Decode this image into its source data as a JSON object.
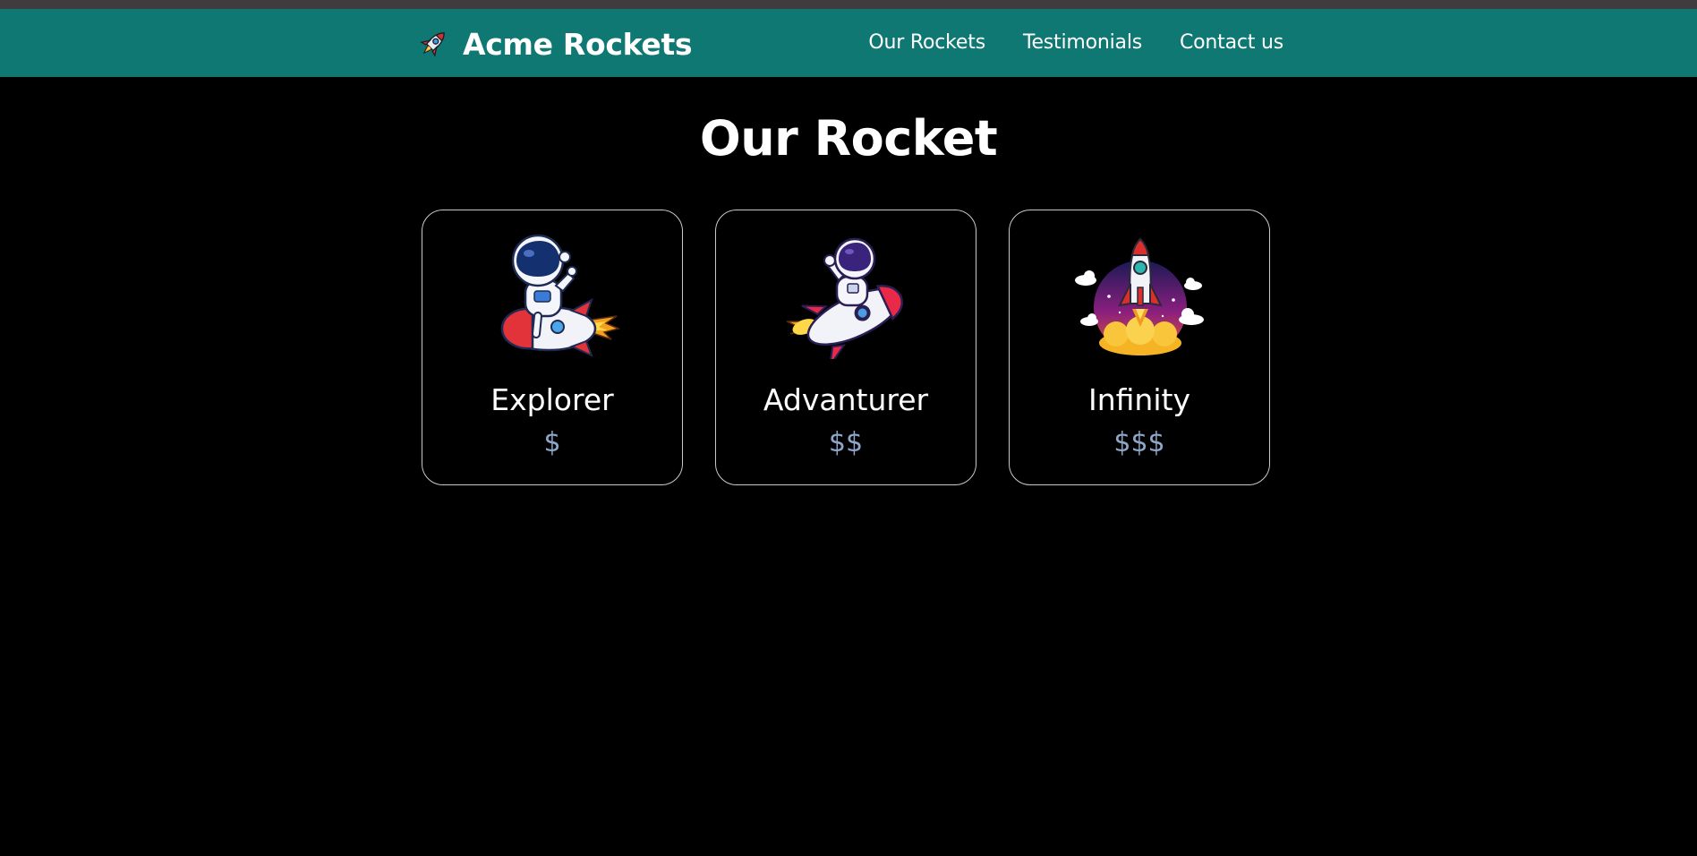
{
  "brand": {
    "name": "Acme Rockets",
    "icon": "rocket-icon"
  },
  "nav": {
    "items": [
      {
        "label": "Our Rockets"
      },
      {
        "label": "Testimonials"
      },
      {
        "label": "Contact us"
      }
    ]
  },
  "main": {
    "title": "Our Rocket",
    "cards": [
      {
        "name": "Explorer",
        "price": "$",
        "image": "astronaut-riding-rocket-image"
      },
      {
        "name": "Advanturer",
        "price": "$$",
        "image": "astronaut-waving-on-rocket-image"
      },
      {
        "name": "Infinity",
        "price": "$$$",
        "image": "rocket-launch-image"
      }
    ]
  },
  "colors": {
    "navbar": "#0f7872",
    "background": "#000000",
    "price": "#8ea6c8",
    "card_border": "#c9c9c9"
  }
}
